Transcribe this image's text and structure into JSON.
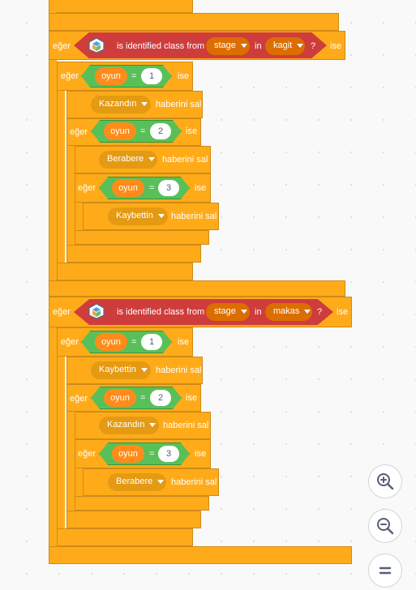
{
  "labels": {
    "if": "eğer",
    "then": "ise",
    "equals": "=",
    "question": "?",
    "identified": "is identified class from",
    "in": "in",
    "broadcast": "haberini sal",
    "var": "oyun"
  },
  "stage": "stage",
  "group1": {
    "class": "kagit",
    "cases": [
      {
        "value": "1",
        "message": "Kazandın"
      },
      {
        "value": "2",
        "message": "Berabere"
      },
      {
        "value": "3",
        "message": "Kaybettin"
      }
    ]
  },
  "group2": {
    "class": "makas",
    "cases": [
      {
        "value": "1",
        "message": "Kaybettin"
      },
      {
        "value": "2",
        "message": "Kazandın"
      },
      {
        "value": "3",
        "message": "Berabere"
      }
    ]
  },
  "colors": {
    "control": "#ffab19",
    "operator": "#59c059",
    "variable": "#ff8c1a",
    "extension": "#cf3c3c",
    "event": "#ffbf00"
  },
  "zoom_controls": [
    "zoom-in-icon",
    "zoom-out-icon",
    "zoom-reset-icon"
  ]
}
